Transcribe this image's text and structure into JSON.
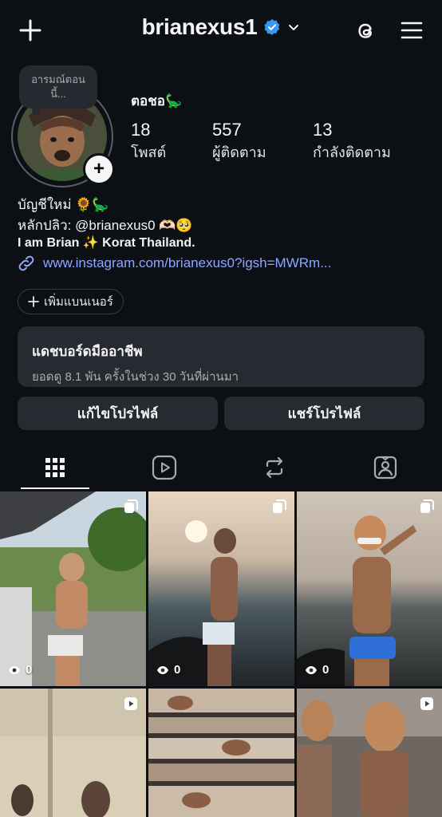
{
  "header": {
    "username": "brianexus1",
    "verified": true,
    "icons": [
      "plus-icon",
      "verified-badge-icon",
      "chevron-down-icon",
      "threads-icon",
      "menu-icon"
    ]
  },
  "profile": {
    "note": "อารมณ์ตอนนี้...",
    "display_name": "ตอชอ🦕",
    "stats": [
      {
        "value": "18",
        "label": "โพสต์"
      },
      {
        "value": "557",
        "label": "ผู้ติดตาม"
      },
      {
        "value": "13",
        "label": "กำลังติดตาม"
      }
    ],
    "bio": [
      "บัญชีใหม่ 🌻🦕",
      "หลักปลิว: @brianexus0 🫶🏻🥺",
      "I am Brian ✨ Korat Thailand."
    ],
    "link": "www.instagram.com/brianexus0?igsh=MWRm..."
  },
  "add_banner": {
    "label": "เพิ่มแบนเนอร์"
  },
  "dashboard": {
    "title": "แดชบอร์ดมืออาชีพ",
    "subtitle": "ยอดดู 8.1 พัน ครั้งในช่วง 30 วันที่ผ่านมา"
  },
  "actions": {
    "edit_profile": "แก้ไขโปรไฟล์",
    "share_profile": "แชร์โปรไฟล์"
  },
  "tabs": [
    "grid-icon",
    "reels-icon",
    "reposts-icon",
    "tagged-icon"
  ],
  "posts": [
    {
      "views": "0",
      "type": "carousel"
    },
    {
      "views": "0",
      "type": "carousel"
    },
    {
      "views": "0",
      "type": "carousel"
    },
    {
      "type": "reel"
    },
    {
      "type": "image"
    },
    {
      "type": "reel"
    }
  ],
  "colors": {
    "background": "#0c1014",
    "link": "#8ea7ff",
    "verified": "#3897f0",
    "button_bg": "#272b31"
  }
}
